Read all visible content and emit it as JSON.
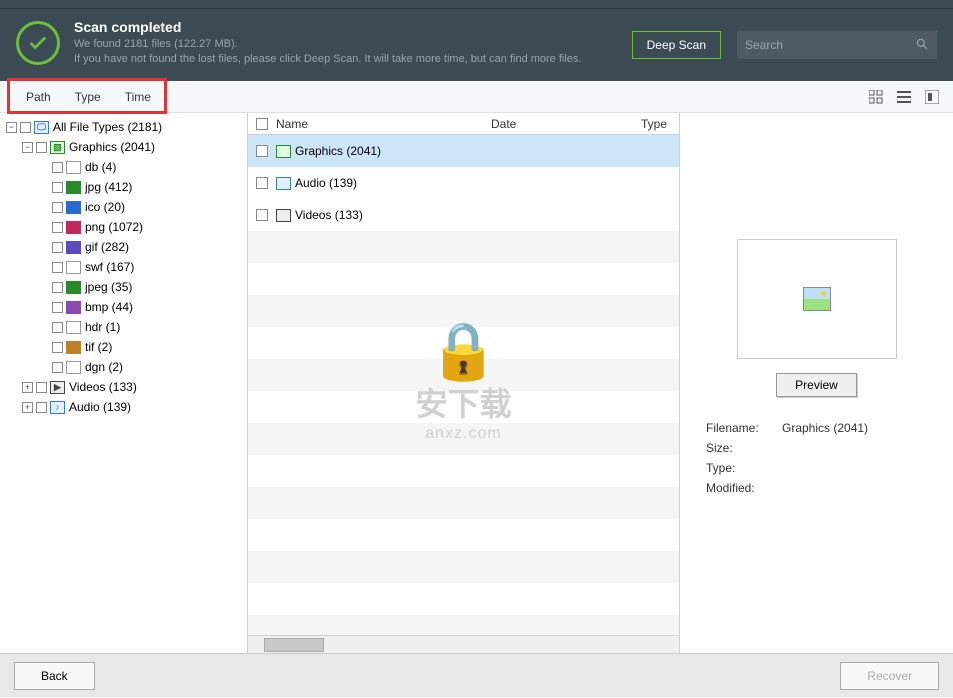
{
  "header": {
    "title": "Scan completed",
    "files_line": "We found 2181 files (122.27 MB).",
    "hint_line": "If you have not found the lost files, please click Deep Scan. It will take more time, but can find more files.",
    "deep_scan": "Deep Scan",
    "search_placeholder": "Search"
  },
  "tabs": {
    "path": "Path",
    "type": "Type",
    "time": "Time"
  },
  "tree": {
    "root": "All File Types (2181)",
    "graphics": "Graphics (2041)",
    "items": [
      {
        "label": "db (4)",
        "ic": "ic-file"
      },
      {
        "label": "jpg (412)",
        "ic": "ic-jpg"
      },
      {
        "label": "ico (20)",
        "ic": "ic-ico"
      },
      {
        "label": "png (1072)",
        "ic": "ic-png"
      },
      {
        "label": "gif (282)",
        "ic": "ic-gif"
      },
      {
        "label": "swf (167)",
        "ic": "ic-file"
      },
      {
        "label": "jpeg (35)",
        "ic": "ic-jpg"
      },
      {
        "label": "bmp (44)",
        "ic": "ic-bmp"
      },
      {
        "label": "hdr (1)",
        "ic": "ic-file"
      },
      {
        "label": "tif (2)",
        "ic": "ic-tif"
      },
      {
        "label": "dgn (2)",
        "ic": "ic-file"
      }
    ],
    "videos": "Videos (133)",
    "audio": "Audio (139)"
  },
  "list": {
    "cols": {
      "name": "Name",
      "date": "Date",
      "type": "Type"
    },
    "rows": [
      {
        "label": "Graphics (2041)",
        "ic": "ic-graphics",
        "sel": true
      },
      {
        "label": "Audio (139)",
        "ic": "ic-audio",
        "sel": false
      },
      {
        "label": "Videos (133)",
        "ic": "ic-video",
        "sel": false
      }
    ]
  },
  "watermark": {
    "cn": "安下载",
    "url": "anxz.com"
  },
  "preview": {
    "button": "Preview",
    "labels": {
      "filename": "Filename:",
      "size": "Size:",
      "type": "Type:",
      "modified": "Modified:"
    },
    "filename": "Graphics (2041)"
  },
  "footer": {
    "back": "Back",
    "recover": "Recover"
  }
}
